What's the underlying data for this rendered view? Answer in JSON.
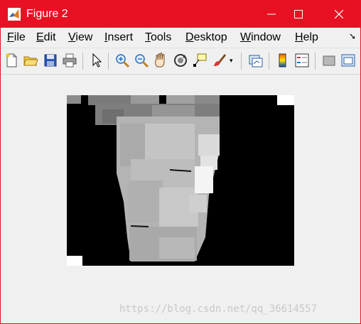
{
  "window": {
    "title": "Figure 2"
  },
  "menu": [
    "File",
    "Edit",
    "View",
    "Insert",
    "Tools",
    "Desktop",
    "Window",
    "Help"
  ],
  "menu_mnemonics": [
    "F",
    "E",
    "V",
    "I",
    "T",
    "D",
    "W",
    "H"
  ],
  "toolbar": {
    "tools": [
      "new-figure-icon",
      "open-file-icon",
      "save-icon",
      "print-icon",
      "pointer-icon",
      "zoom-in-icon",
      "zoom-out-icon",
      "pan-hand-icon",
      "rotate-3d-icon",
      "data-cursor-icon",
      "brush-icon",
      "brush-dropdown-icon",
      "link-plot-icon",
      "colorbar-icon",
      "legend-icon",
      "hide-plot-tools-icon",
      "show-plot-tools-icon"
    ]
  },
  "image": {
    "description": "grayscale depth image of a hand on black background"
  },
  "watermark": "https://blog.csdn.net/qq_36614557",
  "colors": {
    "titlebar": "#e81123",
    "background": "#f0f0f0"
  }
}
